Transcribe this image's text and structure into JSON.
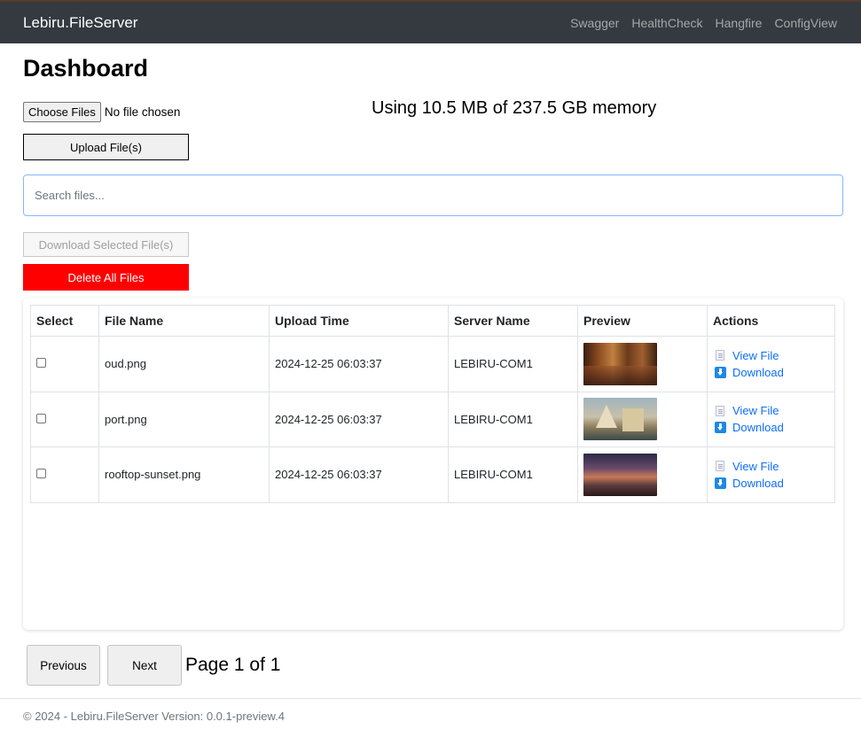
{
  "navbar": {
    "brand": "Lebiru.FileServer",
    "links": [
      "Swagger",
      "HealthCheck",
      "Hangfire",
      "ConfigView"
    ]
  },
  "page": {
    "title": "Dashboard",
    "memory_text": "Using 10.5 MB of 237.5 GB memory"
  },
  "upload": {
    "choose_label": "Choose Files",
    "no_file_text": "No file chosen",
    "upload_label": "Upload File(s)"
  },
  "search": {
    "placeholder": "Search files..."
  },
  "bulk": {
    "download_selected_label": "Download Selected File(s)",
    "delete_all_label": "Delete All Files",
    "delete_color": "#ff0000"
  },
  "table": {
    "headers": [
      "Select",
      "File Name",
      "Upload Time",
      "Server Name",
      "Preview",
      "Actions"
    ],
    "rows": [
      {
        "name": "oud.png",
        "time": "2024-12-25 06:03:37",
        "server": "LEBIRU-COM1",
        "view": "View File",
        "download": "Download",
        "checked": false
      },
      {
        "name": "port.png",
        "time": "2024-12-25 06:03:37",
        "server": "LEBIRU-COM1",
        "view": "View File",
        "download": "Download",
        "checked": false
      },
      {
        "name": "rooftop-sunset.png",
        "time": "2024-12-25 06:03:37",
        "server": "LEBIRU-COM1",
        "view": "View File",
        "download": "Download",
        "checked": false
      }
    ]
  },
  "pagination": {
    "previous_label": "Previous",
    "next_label": "Next",
    "page_text": "Page 1 of 1"
  },
  "footer": {
    "text": "© 2024 - Lebiru.FileServer Version: 0.0.1-preview.4"
  },
  "colors": {
    "navbar": "#343a40",
    "link": "#0d6efd"
  }
}
